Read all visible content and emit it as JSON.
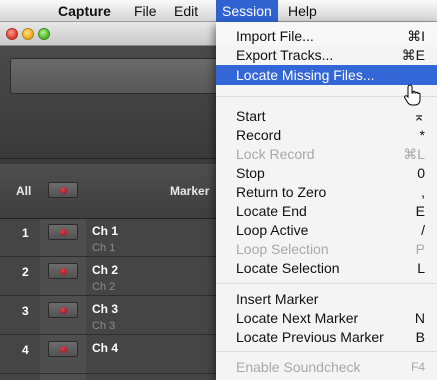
{
  "menubar": {
    "apple": "",
    "app_name": "Capture",
    "file": "File",
    "edit": "Edit",
    "session": "Session",
    "help": "Help"
  },
  "tracks": {
    "header": {
      "all": "All",
      "marker": "Marker"
    },
    "rows": [
      {
        "num": "1",
        "name": "Ch 1",
        "sub": "Ch 1"
      },
      {
        "num": "2",
        "name": "Ch 2",
        "sub": "Ch 2"
      },
      {
        "num": "3",
        "name": "Ch 3",
        "sub": "Ch 3"
      },
      {
        "num": "4",
        "name": "Ch 4",
        "sub": ""
      }
    ]
  },
  "session_menu": {
    "import_file": {
      "label": "Import File...",
      "key": "⌘I"
    },
    "export_tracks": {
      "label": "Export Tracks...",
      "key": "⌘E"
    },
    "locate_missing": {
      "label": "Locate Missing Files...",
      "key": ""
    },
    "start": {
      "label": "Start",
      "key": "⌅"
    },
    "record": {
      "label": "Record",
      "key": "*"
    },
    "lock_record": {
      "label": "Lock Record",
      "key": "⌘L"
    },
    "stop": {
      "label": "Stop",
      "key": "0"
    },
    "return_zero": {
      "label": "Return to Zero",
      "key": ","
    },
    "locate_end": {
      "label": "Locate End",
      "key": "E"
    },
    "loop_active": {
      "label": "Loop Active",
      "key": "/"
    },
    "loop_selection": {
      "label": "Loop Selection",
      "key": "P"
    },
    "locate_selection": {
      "label": "Locate Selection",
      "key": "L"
    },
    "insert_marker": {
      "label": "Insert Marker",
      "key": ""
    },
    "locate_next_marker": {
      "label": "Locate Next Marker",
      "key": "N"
    },
    "locate_prev_marker": {
      "label": "Locate Previous Marker",
      "key": "B"
    },
    "enable_soundcheck": {
      "label": "Enable Soundcheck",
      "key": "F4"
    }
  },
  "colors": {
    "highlight": "#3366d6",
    "record": "#c8102e"
  }
}
